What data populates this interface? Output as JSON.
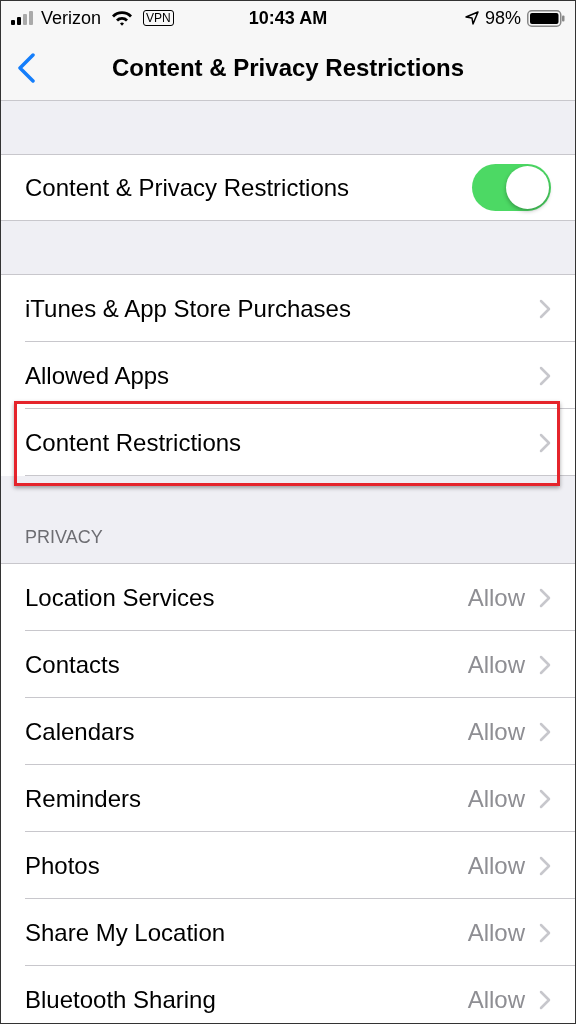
{
  "status_bar": {
    "carrier": "Verizon",
    "vpn": "VPN",
    "time": "10:43 AM",
    "battery": "98%"
  },
  "nav": {
    "title": "Content & Privacy Restrictions"
  },
  "master_toggle": {
    "label": "Content & Privacy Restrictions",
    "on": true
  },
  "sections": [
    {
      "rows": [
        {
          "label": "iTunes & App Store Purchases",
          "highlighted": false
        },
        {
          "label": "Allowed Apps",
          "highlighted": false
        },
        {
          "label": "Content Restrictions",
          "highlighted": true
        }
      ]
    },
    {
      "header": "PRIVACY",
      "rows": [
        {
          "label": "Location Services",
          "value": "Allow",
          "highlighted": false
        },
        {
          "label": "Contacts",
          "value": "Allow",
          "highlighted": false
        },
        {
          "label": "Calendars",
          "value": "Allow",
          "highlighted": false
        },
        {
          "label": "Reminders",
          "value": "Allow",
          "highlighted": false
        },
        {
          "label": "Photos",
          "value": "Allow",
          "highlighted": false
        },
        {
          "label": "Share My Location",
          "value": "Allow",
          "highlighted": false
        },
        {
          "label": "Bluetooth Sharing",
          "value": "Allow",
          "highlighted": false
        }
      ]
    }
  ]
}
